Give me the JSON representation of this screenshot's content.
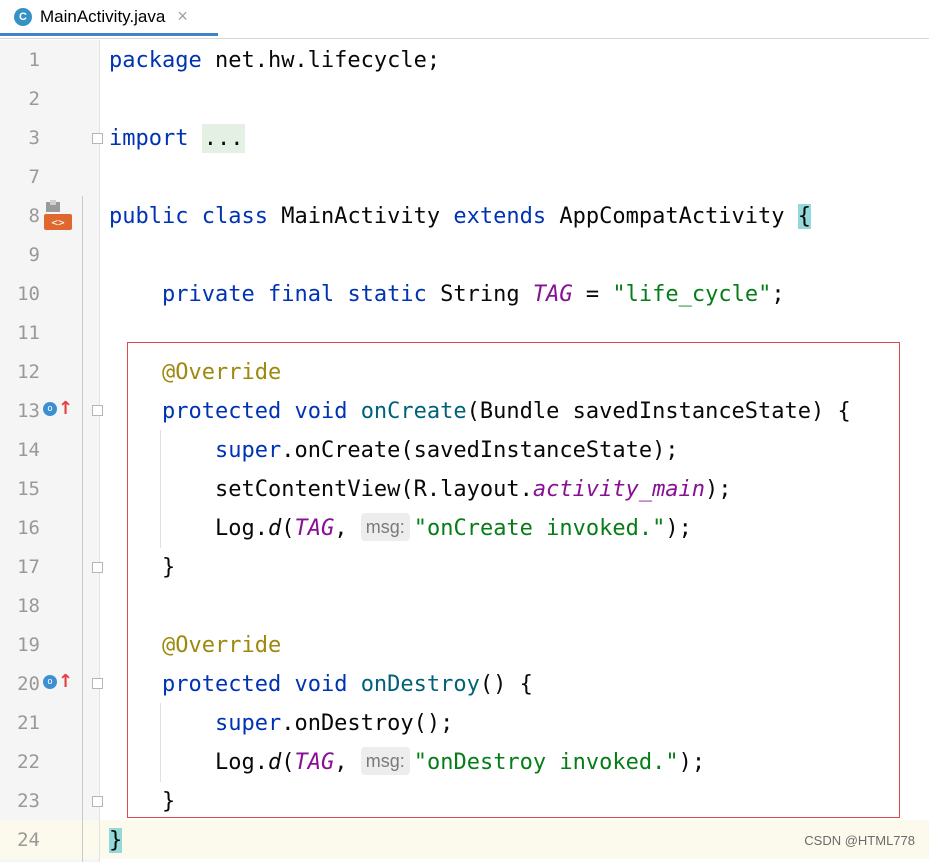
{
  "tab": {
    "label": "MainActivity.java",
    "close_glyph": "×",
    "file_icon": "C"
  },
  "lines": [
    {
      "no": "1",
      "code": "package net.hw.lifecycle;"
    },
    {
      "no": "2",
      "code": ""
    },
    {
      "no": "3",
      "code": "import ..."
    },
    {
      "no": "7",
      "code": ""
    },
    {
      "no": "8",
      "code": "public class MainActivity extends AppCompatActivity {"
    },
    {
      "no": "9",
      "code": ""
    },
    {
      "no": "10",
      "code": "    private final static String TAG = \"life_cycle\";"
    },
    {
      "no": "11",
      "code": ""
    },
    {
      "no": "12",
      "code": "    @Override"
    },
    {
      "no": "13",
      "code": "    protected void onCreate(Bundle savedInstanceState) {"
    },
    {
      "no": "14",
      "code": "        super.onCreate(savedInstanceState);"
    },
    {
      "no": "15",
      "code": "        setContentView(R.layout.activity_main);"
    },
    {
      "no": "16",
      "code": "        Log.d(TAG, msg: \"onCreate invoked.\");"
    },
    {
      "no": "17",
      "code": "    }"
    },
    {
      "no": "18",
      "code": ""
    },
    {
      "no": "19",
      "code": "    @Override"
    },
    {
      "no": "20",
      "code": "    protected void onDestroy() {"
    },
    {
      "no": "21",
      "code": "        super.onDestroy();"
    },
    {
      "no": "22",
      "code": "        Log.d(TAG, msg: \"onDestroy invoked.\");"
    },
    {
      "no": "23",
      "code": "    }"
    },
    {
      "no": "24",
      "code": "}"
    }
  ],
  "tokens": {
    "l1": {
      "kw": "package",
      "rest": " net.hw.lifecycle;"
    },
    "l3": {
      "kw": "import",
      "fold": "..."
    },
    "l8": {
      "kw1": "public",
      "kw2": "class",
      "name": " MainActivity ",
      "kw3": "extends",
      "parent": " AppCompatActivity ",
      "brace": "{"
    },
    "l10": {
      "kw1": "private",
      "kw2": "final",
      "kw3": "static",
      "type": " String ",
      "field": "TAG",
      "eq": " = ",
      "str": "\"life_cycle\"",
      "end": ";"
    },
    "l12": {
      "ann": "@Override"
    },
    "l13": {
      "kw1": "protected",
      "kw2": "void",
      "fn": "onCreate",
      "rest": "(Bundle savedInstanceState) {"
    },
    "l14": {
      "kw": "super",
      "rest": ".onCreate(savedInstanceState);"
    },
    "l15": {
      "a": "setContentView(R.layout.",
      "field": "activity_main",
      "b": ");"
    },
    "l16": {
      "a": "Log.",
      "m": "d",
      "p": "(",
      "field": "TAG",
      "c": ", ",
      "hint": "msg:",
      "str": "\"onCreate invoked.\"",
      "end": ");"
    },
    "l17": {
      "rest": "}"
    },
    "l19": {
      "ann": "@Override"
    },
    "l20": {
      "kw1": "protected",
      "kw2": "void",
      "fn": "onDestroy",
      "rest": "() {"
    },
    "l21": {
      "kw": "super",
      "rest": ".onDestroy();"
    },
    "l22": {
      "a": "Log.",
      "m": "d",
      "p": "(",
      "field": "TAG",
      "c": ", ",
      "hint": "msg:",
      "str": "\"onDestroy invoked.\"",
      "end": ");"
    },
    "l23": {
      "rest": "}"
    },
    "l24": {
      "brace": "}"
    }
  },
  "watermark": "CSDN @HTML778",
  "colors": {
    "keyword": "#0033b3",
    "string": "#067d17",
    "annotation": "#9e880d",
    "field": "#871094",
    "highlight_box": "#e04848",
    "tab_underline": "#4083c9"
  }
}
